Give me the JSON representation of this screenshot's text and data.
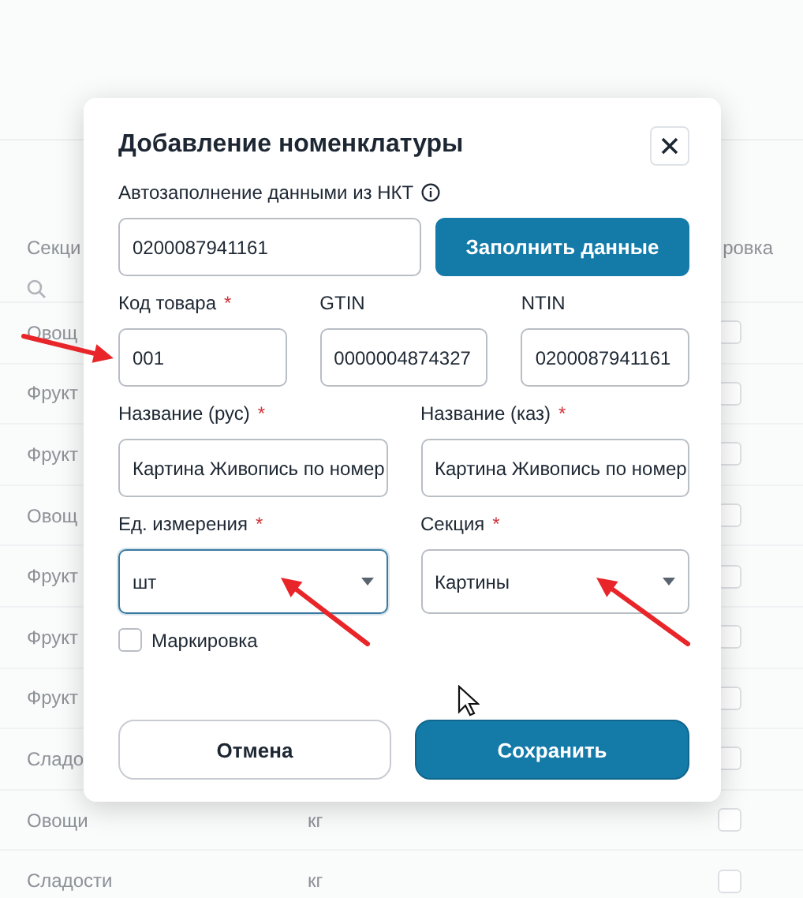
{
  "table": {
    "column_1_header": "Секци",
    "column_3_header": "ровка",
    "rows": [
      {
        "section": "Овощ",
        "checked": false
      },
      {
        "section": "Фрукт",
        "checked": false
      },
      {
        "section": "Фрукт",
        "checked": false
      },
      {
        "section": "Овощ",
        "checked": false
      },
      {
        "section": "Фрукт",
        "checked": false
      },
      {
        "section": "Фрукт",
        "checked": false
      },
      {
        "section": "Фрукт",
        "checked": false
      },
      {
        "section": "Сладо",
        "checked": false
      },
      {
        "section": "Овощи",
        "unit": "кг",
        "checked": false
      },
      {
        "section": "Сладости",
        "unit": "кг",
        "checked": false
      }
    ]
  },
  "dialog": {
    "title": "Добавление номенклатуры",
    "autofill": {
      "label": "Автозаполнение данными из НКТ",
      "value": "0200087941161",
      "button": "Заполнить данные"
    },
    "rows": [
      {
        "fields": [
          {
            "kind": "input",
            "label": "Код товара",
            "required": "*",
            "value": "001",
            "focused": false
          },
          {
            "kind": "input",
            "label": "GTIN",
            "value": "0000004874327",
            "focused": false
          },
          {
            "kind": "input",
            "label": "NTIN",
            "value": "0200087941161",
            "focused": false
          }
        ]
      },
      {
        "fields": [
          {
            "kind": "input",
            "label": "Название (рус)",
            "required": "*",
            "value": "Картина Живопись по номер",
            "focused": false
          },
          {
            "kind": "input",
            "label": "Название (каз)",
            "required": "*",
            "value": "Картина Живопись по номер",
            "focused": false
          }
        ]
      },
      {
        "fields": [
          {
            "kind": "select",
            "label": "Ед. измерения",
            "required": "*",
            "value": "шт",
            "focused": true
          },
          {
            "kind": "select",
            "label": "Секция",
            "required": "*",
            "value": "Картины",
            "focused": false
          }
        ]
      }
    ],
    "checkbox": {
      "label": "Маркировка",
      "checked": false
    },
    "buttons": [
      {
        "label": "Отмена",
        "kind": "secondary"
      },
      {
        "label": "Сохранить",
        "kind": "primary"
      }
    ]
  }
}
